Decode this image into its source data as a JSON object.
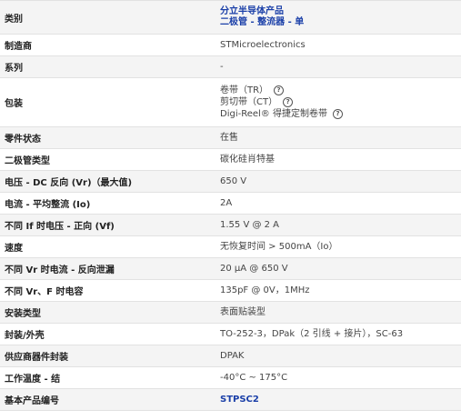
{
  "rows": [
    {
      "label": "类别",
      "links": [
        "分立半导体产品",
        "二极管 - 整流器 - 单"
      ]
    },
    {
      "label": "制造商",
      "value": "STMicroelectronics"
    },
    {
      "label": "系列",
      "value": "-"
    },
    {
      "label": "包装",
      "packaging": [
        "卷带（TR）",
        "剪切带（CT）",
        "Digi-Reel® 得捷定制卷带"
      ],
      "help_glyph": "?"
    },
    {
      "label": "零件状态",
      "value": "在售"
    },
    {
      "label": "二极管类型",
      "value": "碳化硅肖特基"
    },
    {
      "label": "电压 - DC 反向 (Vr)（最大值)",
      "value": "650 V"
    },
    {
      "label": "电流 - 平均整流 (Io)",
      "value": "2A"
    },
    {
      "label": "不同 If 时电压 - 正向 (Vf)",
      "value": "1.55 V @ 2 A"
    },
    {
      "label": "速度",
      "value": "无恢复时间 > 500mA（Io）"
    },
    {
      "label": "不同 Vr 时电流 - 反向泄漏",
      "value": "20 µA @ 650 V"
    },
    {
      "label": "不同 Vr、F 时电容",
      "value": "135pF @ 0V，1MHz"
    },
    {
      "label": "安装类型",
      "value": "表面贴装型"
    },
    {
      "label": "封装/外壳",
      "value": "TO-252-3，DPak（2 引线 + 接片），SC-63"
    },
    {
      "label": "供应商器件封装",
      "value": "DPAK"
    },
    {
      "label": "工作温度 - 结",
      "value": "-40°C ~ 175°C"
    },
    {
      "label": "基本产品编号",
      "link": "STPSC2"
    }
  ],
  "colors": {
    "link": "#1a3fa8",
    "row_alt": "#f4f4f4",
    "border": "#e2e2e2"
  }
}
